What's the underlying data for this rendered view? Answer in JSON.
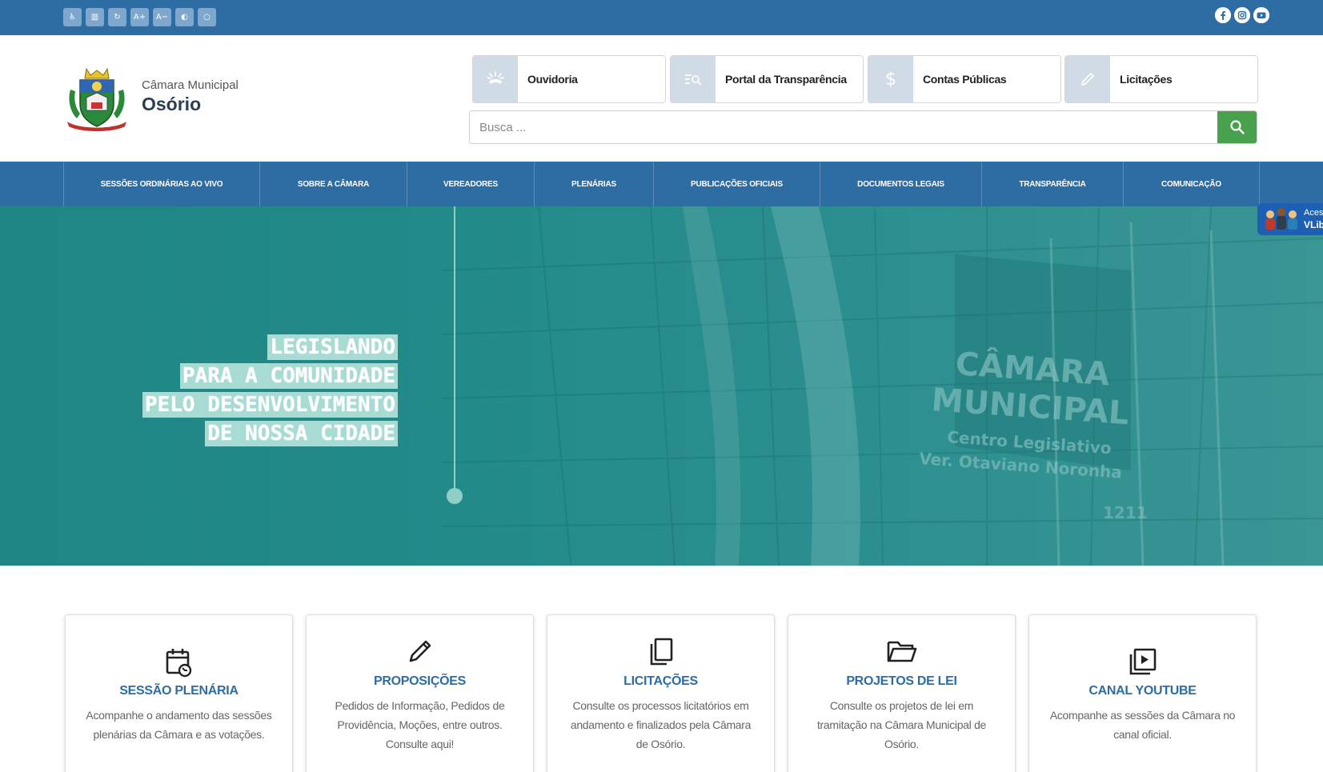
{
  "topbar": {
    "accessibility_tools": [
      {
        "icon": "wheelchair-icon",
        "glyph": "♿"
      },
      {
        "icon": "map-icon",
        "glyph": "▥"
      },
      {
        "icon": "reset-icon",
        "glyph": "↻"
      },
      {
        "icon": "font-increase-icon",
        "glyph": "A+"
      },
      {
        "icon": "font-decrease-icon",
        "glyph": "A−"
      },
      {
        "icon": "contrast-icon",
        "glyph": "◐"
      },
      {
        "icon": "circle-icon",
        "glyph": "○"
      }
    ],
    "social": [
      "facebook-icon",
      "instagram-icon",
      "youtube-icon"
    ]
  },
  "header": {
    "brand_top": "Câmara Municipal",
    "brand_name": "Osório",
    "quick_links": [
      {
        "label": "Ouvidoria",
        "icon": "megaphone-icon"
      },
      {
        "label": "Portal da Transparência",
        "icon": "search-list-icon"
      },
      {
        "label": "Contas Públicas",
        "icon": "dollar-icon"
      },
      {
        "label": "Licitações",
        "icon": "pencil-icon"
      }
    ],
    "search": {
      "placeholder": "Busca ..."
    }
  },
  "nav": {
    "items": [
      "SESSÕES ORDINÁRIAS AO VIVO",
      "SOBRE A CÂMARA",
      "VEREADORES",
      "PLENÁRIAS",
      "PUBLICAÇÕES OFICIAIS",
      "DOCUMENTOS LEGAIS",
      "TRANSPARÊNCIA",
      "COMUNICAÇÃO"
    ]
  },
  "hero": {
    "slogan": [
      "LEGISLANDO",
      "PARA A COMUNIDADE",
      "PELO DESENVOLVIMENTO",
      "DE NOSSA CIDADE"
    ],
    "building_text": [
      "CÂMARA",
      "MUNICIPAL",
      "Centro Legislativo",
      "Ver. Otaviano Noronha",
      "1211"
    ]
  },
  "vlibras": {
    "line1": "Aces",
    "line2": "VLib"
  },
  "cards": [
    {
      "title": "SESSÃO PLENÁRIA",
      "desc": "Acompanhe o andamento das sessões plenárias da Câmara e as votações.",
      "icon": "calendar-icon"
    },
    {
      "title": "PROPOSIÇÕES",
      "desc": "Pedidos de Informação, Pedidos de Providência, Moções, entre outros. Consulte aqui!",
      "icon": "pencil-icon"
    },
    {
      "title": "LICITAÇÕES",
      "desc": "Consulte os processos licitatórios em andamento e finalizados pela Câmara de Osório.",
      "icon": "copy-icon"
    },
    {
      "title": "PROJETOS DE LEI",
      "desc": "Consulte os projetos de lei em tramitação na Câmara Municipal de Osório.",
      "icon": "folder-icon"
    },
    {
      "title": "CANAL YOUTUBE",
      "desc": "Acompanhe as sessões da Câmara no canal oficial.",
      "icon": "play-icon"
    }
  ],
  "colors": {
    "primary": "#2e6da4",
    "hero": "#238a8a",
    "accent_green": "#48a14d",
    "slogan_bg": "#a7dbd3"
  }
}
